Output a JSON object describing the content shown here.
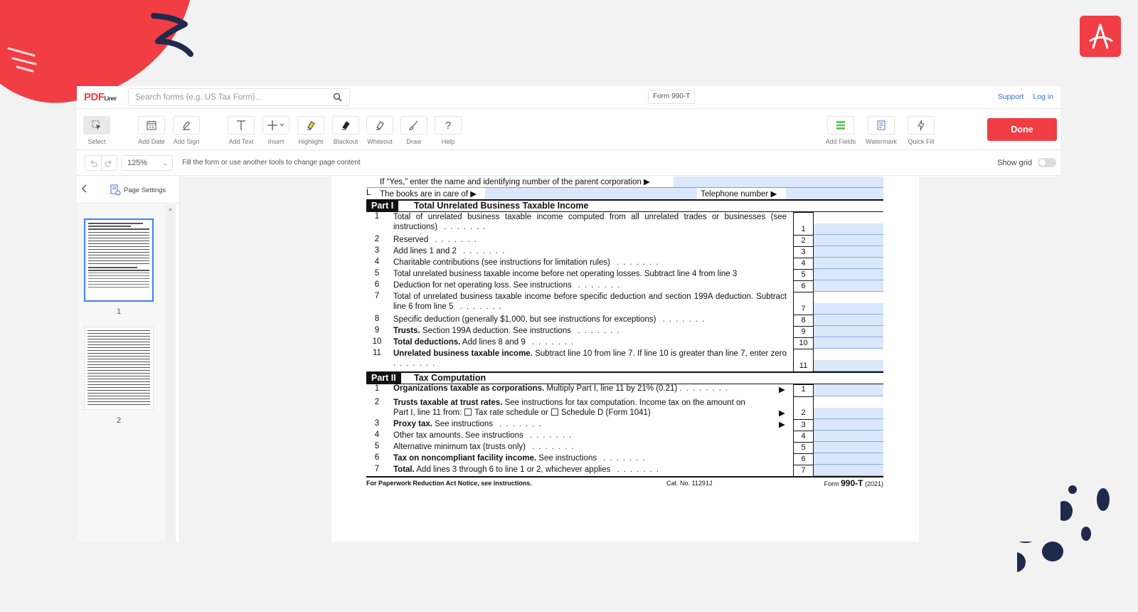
{
  "brand": {
    "name": "PDF",
    "sub": "Liner"
  },
  "search": {
    "placeholder": "Search forms (e.g. US Tax Form)..."
  },
  "document": {
    "title": "Form 990-T"
  },
  "top_links": [
    "Support",
    "Log in"
  ],
  "tools": [
    {
      "label": "Select",
      "icon": "select-cursor-icon"
    },
    {
      "label": "Add Date",
      "icon": "calendar-icon"
    },
    {
      "label": "Add Sign",
      "icon": "signature-pen-icon"
    },
    {
      "label": "Add Text",
      "icon": "text-t-icon"
    },
    {
      "label": "Insert",
      "icon": "plus-icon"
    },
    {
      "label": "Highlight",
      "icon": "highlighter-icon"
    },
    {
      "label": "Blackout",
      "icon": "blackout-marker-icon"
    },
    {
      "label": "Whiteout",
      "icon": "eraser-icon"
    },
    {
      "label": "Draw",
      "icon": "brush-icon"
    },
    {
      "label": "Help",
      "icon": "question-icon"
    },
    {
      "label": "Add Fields",
      "icon": "fields-icon"
    },
    {
      "label": "Watermark",
      "icon": "watermark-icon"
    },
    {
      "label": "Quick Fill",
      "icon": "lightning-icon"
    }
  ],
  "done_label": "Done",
  "subbar": {
    "zoom": "125%",
    "hint": "Fill the form or use another tools to change page content",
    "show_grid": "Show grid"
  },
  "sidebar": {
    "page_settings": "Page Settings",
    "pages": [
      "1",
      "2"
    ]
  },
  "form": {
    "parent_corp": "If “Yes,” enter the name and identifying number of the parent corporation ▶",
    "books_letter": "L",
    "books_text": "The books are in care of ▶",
    "telephone": "Telephone number ▶",
    "part1": {
      "tag": "Part I",
      "title": "Total Unrelated Business Taxable Income",
      "lines": [
        {
          "num": "1",
          "bold": "",
          "text": "Total of unrelated business taxable income computed from all unrelated trades or businesses (see instructions)",
          "box": "1"
        },
        {
          "num": "2",
          "bold": "",
          "text": "Reserved",
          "box": "2"
        },
        {
          "num": "3",
          "bold": "",
          "text": "Add lines 1 and 2",
          "box": "3"
        },
        {
          "num": "4",
          "bold": "",
          "text": "Charitable contributions (see instructions for limitation rules)",
          "box": "4"
        },
        {
          "num": "5",
          "bold": "",
          "text": "Total unrelated business taxable income before net operating losses. Subtract line 4 from line 3",
          "box": "5"
        },
        {
          "num": "6",
          "bold": "",
          "text": "Deduction for net operating loss. See instructions",
          "box": "6"
        },
        {
          "num": "7",
          "bold": "",
          "text": "Total of unrelated business taxable income before specific deduction and section 199A deduction. Subtract line 6 from line 5",
          "box": "7"
        },
        {
          "num": "8",
          "bold": "",
          "text": "Specific deduction (generally $1,000, but see instructions for exceptions)",
          "box": "8"
        },
        {
          "num": "9",
          "bold": "Trusts.",
          "text": " Section 199A deduction. See instructions",
          "box": "9"
        },
        {
          "num": "10",
          "bold": "Total deductions.",
          "text": " Add lines 8 and 9",
          "box": "10"
        },
        {
          "num": "11",
          "bold": "Unrelated business taxable income.",
          "text": " Subtract line 10 from line 7. If line 10 is greater than line 7, enter zero",
          "box": "11"
        }
      ]
    },
    "part2": {
      "tag": "Part II",
      "title": "Tax Computation",
      "line1": {
        "num": "1",
        "bold": "Organizations taxable as corporations.",
        "text": " Multiply Part I, line 11 by 21% (0.21)",
        "arrow": "▶",
        "box": "1"
      },
      "line2": {
        "num": "2",
        "bold": "Trusts taxable at trust rates.",
        "text": " See instructions for tax computation. Income tax on the amount on",
        "text2": "Part I, line 11 from:",
        "opt1": "Tax rate schedule or",
        "opt2": "Schedule D (Form 1041)",
        "arrow": "▶",
        "box": "2"
      },
      "lines": [
        {
          "num": "3",
          "bold": "Proxy tax.",
          "text": " See instructions",
          "arrow": "▶",
          "box": "3"
        },
        {
          "num": "4",
          "bold": "",
          "text": "Other tax amounts. See instructions",
          "arrow": "",
          "box": "4"
        },
        {
          "num": "5",
          "bold": "",
          "text": "Alternative minimum tax (trusts only)",
          "arrow": "",
          "box": "5"
        },
        {
          "num": "6",
          "bold": "Tax on noncompliant facility income.",
          "text": " See instructions",
          "arrow": "",
          "box": "6"
        },
        {
          "num": "7",
          "bold": "Total.",
          "text": " Add lines 3 through 6 to line 1 or 2, whichever applies",
          "arrow": "",
          "box": "7"
        }
      ]
    },
    "footer": {
      "notice": "For Paperwork Reduction Act Notice, see instructions.",
      "cat": "Cat. No. 11291J",
      "form_prefix": "Form",
      "form_name": "990-T",
      "form_year": "(2021)"
    }
  },
  "colors": {
    "accent": "#f03e44",
    "link": "#2f6fd6",
    "field": "#dbe8fb"
  }
}
